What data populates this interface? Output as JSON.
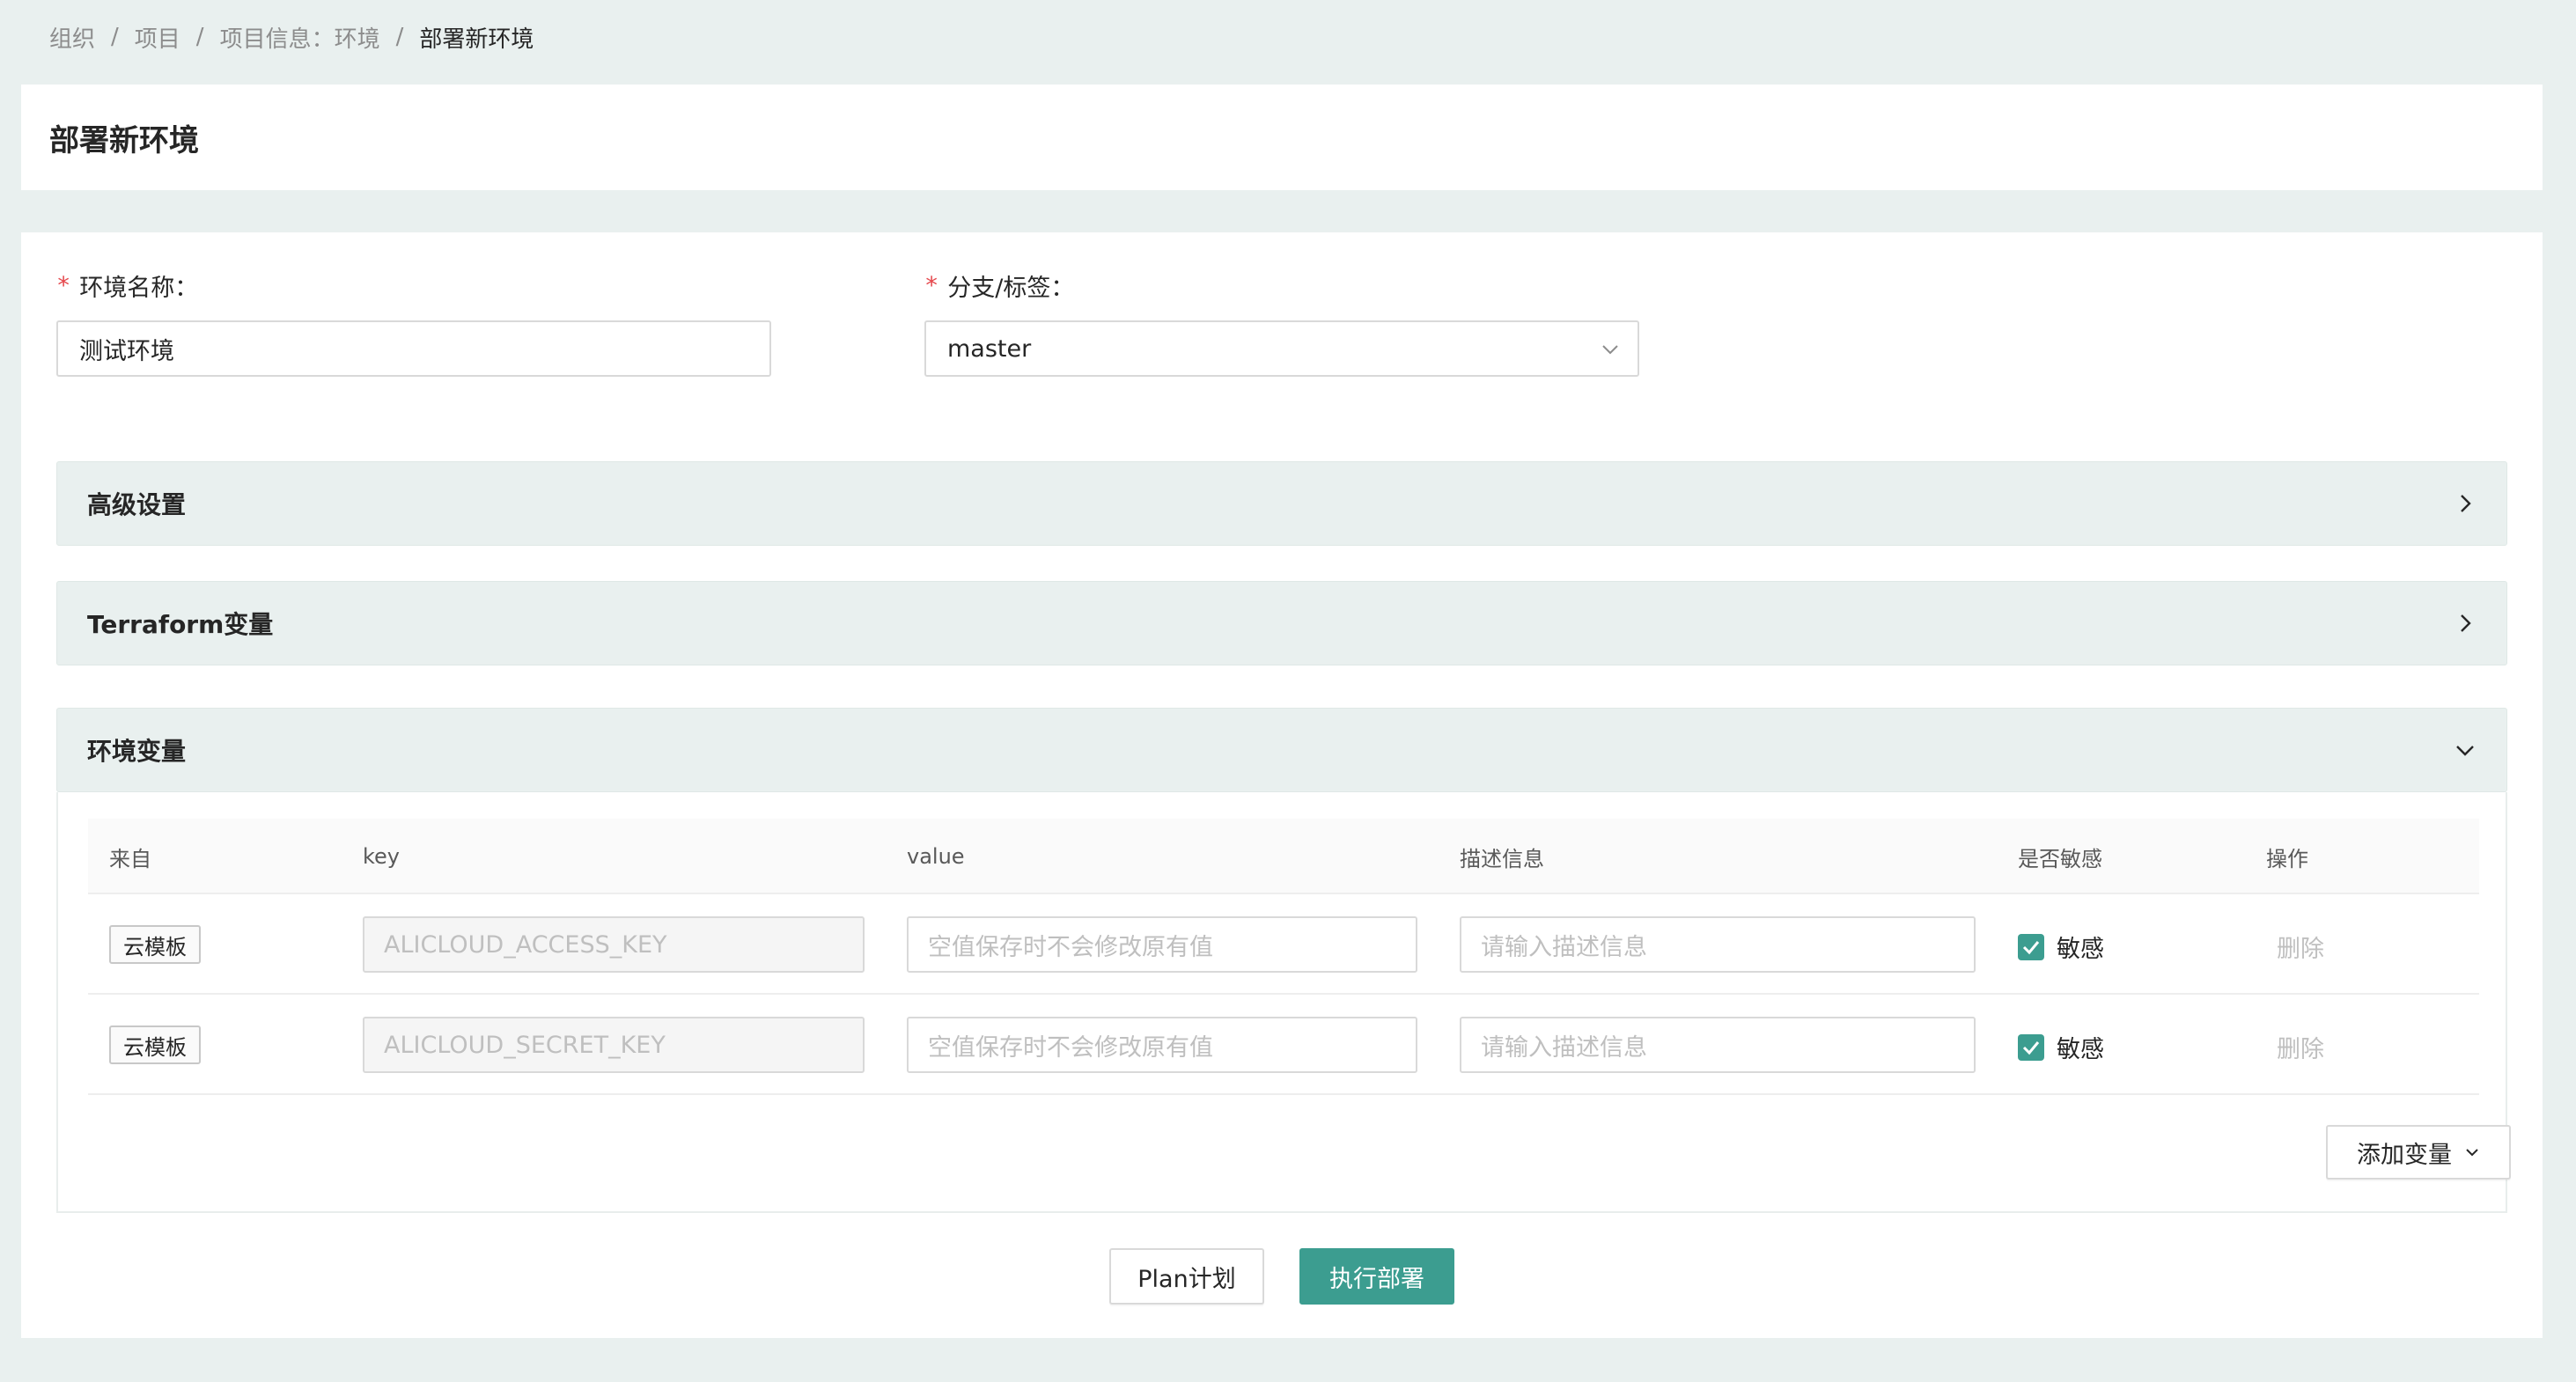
{
  "breadcrumb": {
    "items": [
      "组织",
      "项目",
      "项目信息：环境",
      "部署新环境"
    ],
    "separator": "/"
  },
  "page_title": "部署新环境",
  "form": {
    "env_name": {
      "label": "环境名称：",
      "value": "测试环境"
    },
    "branch": {
      "label": "分支/标签：",
      "value": "master"
    }
  },
  "panels": {
    "advanced": "高级设置",
    "terraform": "Terraform变量",
    "env_vars": "环境变量"
  },
  "table": {
    "headers": [
      "来自",
      "key",
      "value",
      "描述信息",
      "是否敏感",
      "操作"
    ],
    "rows": [
      {
        "source": "云模板",
        "key": "ALICLOUD_ACCESS_KEY",
        "value_placeholder": "空值保存时不会修改原有值",
        "desc_placeholder": "请输入描述信息",
        "sensitive_label": "敏感",
        "sensitive": true,
        "action": "删除"
      },
      {
        "source": "云模板",
        "key": "ALICLOUD_SECRET_KEY",
        "value_placeholder": "空值保存时不会修改原有值",
        "desc_placeholder": "请输入描述信息",
        "sensitive_label": "敏感",
        "sensitive": true,
        "action": "删除"
      }
    ]
  },
  "buttons": {
    "add_variable": "添加变量",
    "plan": "Plan计划",
    "deploy": "执行部署"
  },
  "colors": {
    "accent": "#3c9d90",
    "page_bg": "#e9f0ef",
    "required": "#e5484d"
  }
}
